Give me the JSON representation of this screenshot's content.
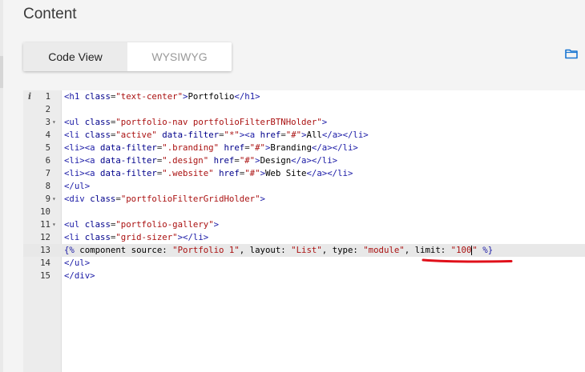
{
  "page": {
    "title": "Content"
  },
  "tabs": [
    {
      "label": "Code View",
      "active": true
    },
    {
      "label": "WYSIWYG",
      "active": false
    }
  ],
  "colors": {
    "accent_blue": "#1976d2",
    "annotation_red": "#e0101a"
  },
  "icons": {
    "folder": "folder-icon",
    "info": "info-icon"
  },
  "editor": {
    "lines": [
      {
        "n": "1",
        "fold": false,
        "info": true,
        "tokens": [
          [
            "t",
            "<h1 "
          ],
          [
            "a",
            "class"
          ],
          [
            "p",
            "="
          ],
          [
            "s",
            "\"text-center\""
          ],
          [
            "t",
            ">"
          ],
          [
            "tx",
            "Portfolio"
          ],
          [
            "t",
            "</h1>"
          ]
        ]
      },
      {
        "n": "2",
        "fold": false,
        "tokens": []
      },
      {
        "n": "3",
        "fold": true,
        "tokens": [
          [
            "t",
            "<ul "
          ],
          [
            "a",
            "class"
          ],
          [
            "p",
            "="
          ],
          [
            "s",
            "\"portfolio-nav portfolioFilterBTNHolder\""
          ],
          [
            "t",
            ">"
          ]
        ]
      },
      {
        "n": "4",
        "fold": false,
        "tokens": [
          [
            "t",
            "<li "
          ],
          [
            "a",
            "class"
          ],
          [
            "p",
            "="
          ],
          [
            "s",
            "\"active\""
          ],
          [
            "tx",
            " "
          ],
          [
            "a",
            "data-filter"
          ],
          [
            "p",
            "="
          ],
          [
            "s",
            "\"*\""
          ],
          [
            "t",
            "><a "
          ],
          [
            "a",
            "href"
          ],
          [
            "p",
            "="
          ],
          [
            "s",
            "\"#\""
          ],
          [
            "t",
            ">"
          ],
          [
            "tx",
            "All"
          ],
          [
            "t",
            "</a></li>"
          ]
        ]
      },
      {
        "n": "5",
        "fold": false,
        "tokens": [
          [
            "t",
            "<li><a "
          ],
          [
            "a",
            "data-filter"
          ],
          [
            "p",
            "="
          ],
          [
            "s",
            "\".branding\""
          ],
          [
            "tx",
            " "
          ],
          [
            "a",
            "href"
          ],
          [
            "p",
            "="
          ],
          [
            "s",
            "\"#\""
          ],
          [
            "t",
            ">"
          ],
          [
            "tx",
            "Branding"
          ],
          [
            "t",
            "</a></li>"
          ]
        ]
      },
      {
        "n": "6",
        "fold": false,
        "tokens": [
          [
            "t",
            "<li><a "
          ],
          [
            "a",
            "data-filter"
          ],
          [
            "p",
            "="
          ],
          [
            "s",
            "\".design\""
          ],
          [
            "tx",
            " "
          ],
          [
            "a",
            "href"
          ],
          [
            "p",
            "="
          ],
          [
            "s",
            "\"#\""
          ],
          [
            "t",
            ">"
          ],
          [
            "tx",
            "Design"
          ],
          [
            "t",
            "</a></li>"
          ]
        ]
      },
      {
        "n": "7",
        "fold": false,
        "tokens": [
          [
            "t",
            "<li><a "
          ],
          [
            "a",
            "data-filter"
          ],
          [
            "p",
            "="
          ],
          [
            "s",
            "\".website\""
          ],
          [
            "tx",
            " "
          ],
          [
            "a",
            "href"
          ],
          [
            "p",
            "="
          ],
          [
            "s",
            "\"#\""
          ],
          [
            "t",
            ">"
          ],
          [
            "tx",
            "Web Site"
          ],
          [
            "t",
            "</a></li>"
          ]
        ]
      },
      {
        "n": "8",
        "fold": false,
        "tokens": [
          [
            "t",
            "</ul>"
          ]
        ]
      },
      {
        "n": "9",
        "fold": true,
        "tokens": [
          [
            "t",
            "<div "
          ],
          [
            "a",
            "class"
          ],
          [
            "p",
            "="
          ],
          [
            "s",
            "\"portfolioFilterGridHolder\""
          ],
          [
            "t",
            ">"
          ]
        ]
      },
      {
        "n": "10",
        "fold": false,
        "tokens": []
      },
      {
        "n": "11",
        "fold": true,
        "tokens": [
          [
            "t",
            "<ul "
          ],
          [
            "a",
            "class"
          ],
          [
            "p",
            "="
          ],
          [
            "s",
            "\"portfolio-gallery\""
          ],
          [
            "t",
            ">"
          ]
        ]
      },
      {
        "n": "12",
        "fold": false,
        "tokens": [
          [
            "t",
            "<li "
          ],
          [
            "a",
            "class"
          ],
          [
            "p",
            "="
          ],
          [
            "s",
            "\"grid-sizer\""
          ],
          [
            "t",
            "></li>"
          ]
        ]
      },
      {
        "n": "13",
        "fold": false,
        "active": true,
        "tokens": [
          [
            "kw",
            "{%"
          ],
          [
            "k",
            " component source: "
          ],
          [
            "s",
            "\"Portfolio 1\""
          ],
          [
            "k",
            ", layout: "
          ],
          [
            "s",
            "\"List\""
          ],
          [
            "k",
            ", type: "
          ],
          [
            "s",
            "\"module\""
          ],
          [
            "k",
            ", limit: "
          ],
          [
            "s",
            "\"100"
          ],
          [
            "cursor",
            ""
          ],
          [
            "s",
            "\""
          ],
          [
            "k",
            " "
          ],
          [
            "kw",
            "%}"
          ]
        ]
      },
      {
        "n": "14",
        "fold": false,
        "tokens": [
          [
            "t",
            "</ul>"
          ]
        ]
      },
      {
        "n": "15",
        "fold": false,
        "tokens": [
          [
            "t",
            "</div>"
          ]
        ]
      }
    ]
  }
}
